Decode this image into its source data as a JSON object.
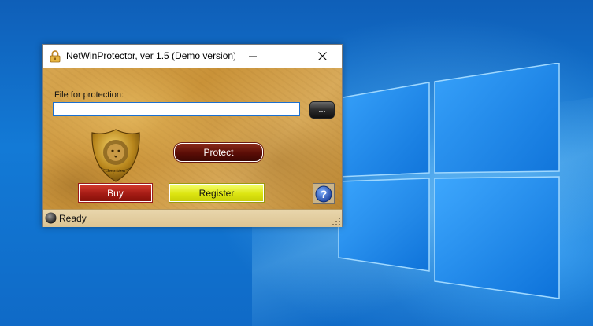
{
  "window": {
    "title": "NetWinProtector, ver 1.5 (Demo version)",
    "icon": "lock-icon",
    "controls": {
      "minimize": "minimize-icon",
      "maximize": "maximize-icon",
      "close": "close-icon"
    }
  },
  "form": {
    "file_label": "File for protection:",
    "file_value": "",
    "browse_label": "...",
    "protect_label": "Protect",
    "buy_label": "Buy",
    "register_label": "Register",
    "help_icon": "help-icon",
    "logo_text": "Serp Lion"
  },
  "status": {
    "text": "Ready",
    "indicator": "status-indicator-icon"
  },
  "colors": {
    "desktop_blue": "#1473c9",
    "protect": "#5a0d06",
    "buy": "#a51c15",
    "register": "#dde512",
    "input_border": "#1a6fd1"
  }
}
